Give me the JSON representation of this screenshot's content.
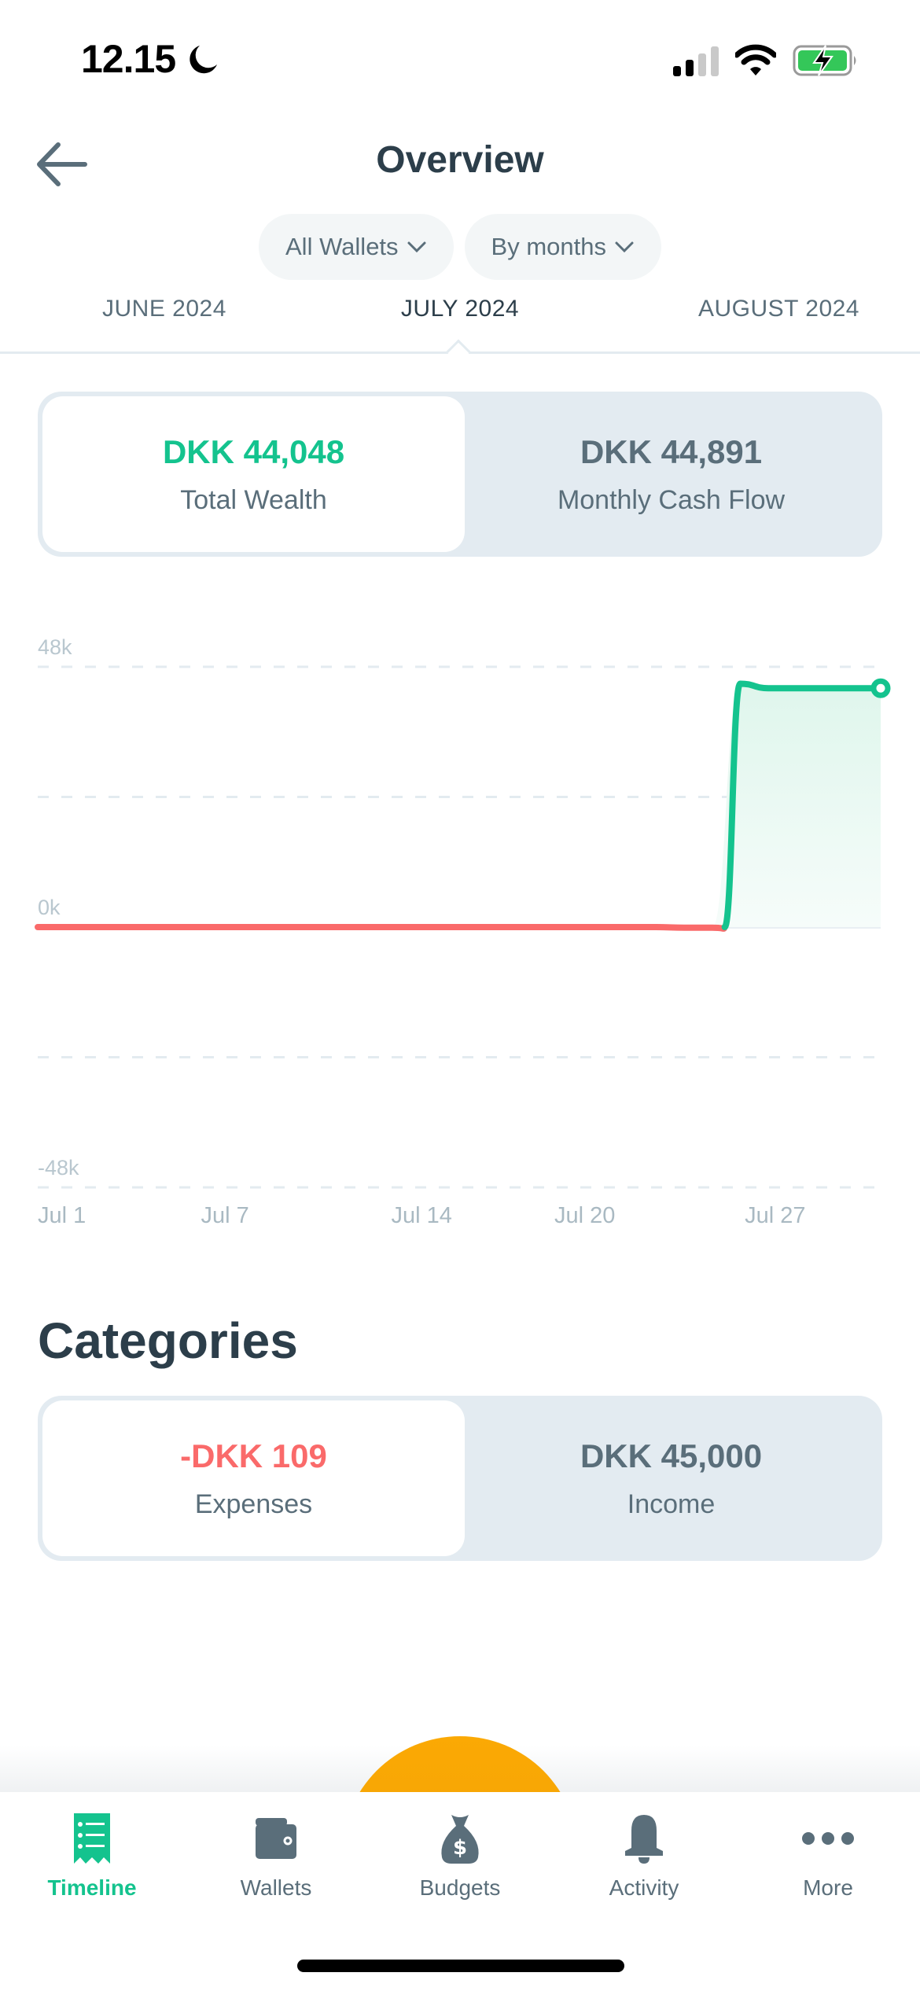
{
  "status_bar": {
    "time": "12.15",
    "icons": [
      "moon-icon",
      "cellular-signal-icon",
      "wifi-icon",
      "battery-charging-icon"
    ]
  },
  "header": {
    "back_icon": "arrow-left-icon",
    "title": "Overview"
  },
  "filters": {
    "wallet_filter": "All Wallets",
    "period_filter": "By months",
    "chevron_icon": "chevron-down-icon"
  },
  "month_tabs": {
    "previous": "JUNE 2024",
    "current": "JULY 2024",
    "next": "AUGUST 2024"
  },
  "wealth_toggle": {
    "left": {
      "amount": "DKK 44,048",
      "label": "Total Wealth",
      "selected": true
    },
    "right": {
      "amount": "DKK 44,891",
      "label": "Monthly Cash Flow",
      "selected": false
    }
  },
  "chart_data": {
    "type": "area",
    "title": "",
    "xlabel": "",
    "ylabel": "",
    "x_tick_labels": [
      "Jul 1",
      "Jul 7",
      "Jul 14",
      "Jul 20",
      "Jul 27"
    ],
    "y_tick_labels": [
      "48k",
      "0k",
      "-48k"
    ],
    "ylim": [
      -48000,
      48000
    ],
    "grid": true,
    "series": [
      {
        "name": "Total Wealth",
        "x": [
          1,
          2,
          3,
          4,
          5,
          6,
          7,
          8,
          9,
          10,
          11,
          12,
          13,
          14,
          15,
          16,
          17,
          18,
          19,
          20,
          21,
          22,
          23,
          24,
          25,
          26,
          27,
          28,
          29,
          30,
          31
        ],
        "values": [
          0,
          0,
          0,
          0,
          0,
          0,
          0,
          0,
          0,
          0,
          0,
          0,
          0,
          0,
          0,
          0,
          0,
          0,
          0,
          0,
          0,
          0,
          0,
          -109,
          -109,
          44891,
          44048,
          44048,
          44048,
          44048,
          44048
        ]
      }
    ],
    "colors": {
      "positive": "#14c38e",
      "negative": "#fa6a6a",
      "fill": "#e0f6ee",
      "grid": "#e3ebf0",
      "axis_text": "#b9c7cf"
    }
  },
  "categories": {
    "title": "Categories",
    "left": {
      "amount": "-DKK 109",
      "label": "Expenses",
      "selected": true
    },
    "right": {
      "amount": "DKK 45,000",
      "label": "Income",
      "selected": false
    }
  },
  "bottom_nav": {
    "items": [
      {
        "label": "Timeline",
        "icon": "receipt-list-icon",
        "active": true
      },
      {
        "label": "Wallets",
        "icon": "wallet-icon",
        "active": false
      },
      {
        "label": "Budgets",
        "icon": "money-bag-icon",
        "active": false
      },
      {
        "label": "Activity",
        "icon": "bell-icon",
        "active": false
      },
      {
        "label": "More",
        "icon": "more-dots-icon",
        "active": false
      }
    ]
  },
  "colors": {
    "brand_green": "#14c38e",
    "expense_red": "#fa6a6a",
    "text_dark": "#2c3e4a",
    "text_muted": "#5a6e7a",
    "fab_orange": "#fba904"
  }
}
